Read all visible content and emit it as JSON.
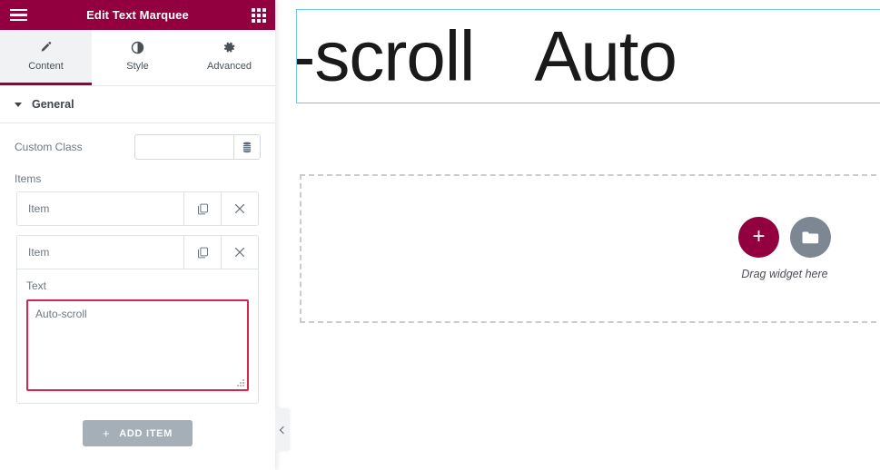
{
  "panel": {
    "header": {
      "title": "Edit Text Marquee",
      "menu_icon": "hamburger-icon",
      "apps_icon": "grid-icon"
    },
    "tabs": [
      {
        "label": "Content",
        "icon": "pencil-icon",
        "active": true
      },
      {
        "label": "Style",
        "icon": "contrast-circle-icon",
        "active": false
      },
      {
        "label": "Advanced",
        "icon": "gear-icon",
        "active": false
      }
    ],
    "section": {
      "title": "General",
      "expanded": true
    },
    "controls": {
      "custom_class": {
        "label": "Custom Class",
        "value": "",
        "placeholder": "",
        "dynamic_tag_icon": "database-stack-icon"
      },
      "items_label": "Items",
      "items": [
        {
          "title": "Item",
          "expanded": false,
          "duplicate_icon": "copy-icon",
          "remove_icon": "close-icon"
        },
        {
          "title": "Item",
          "expanded": true,
          "duplicate_icon": "copy-icon",
          "remove_icon": "close-icon",
          "field_label": "Text",
          "field_value": "Auto-scroll"
        }
      ],
      "add_item": {
        "label": "ADD ITEM",
        "plus": "+"
      }
    }
  },
  "canvas": {
    "collapse_handle": {
      "icon": "chevron-left-icon"
    },
    "marquee": {
      "visible_text": "o-scroll",
      "visible_text_2": "Auto",
      "selected": true,
      "border_color": "#6ec6e8"
    },
    "dropzone": {
      "caption": "Drag widget here",
      "add_button_icon": "plus-icon",
      "folder_button_icon": "folder-icon",
      "add_button_color": "#93003f",
      "folder_button_color": "#7d8793"
    }
  }
}
